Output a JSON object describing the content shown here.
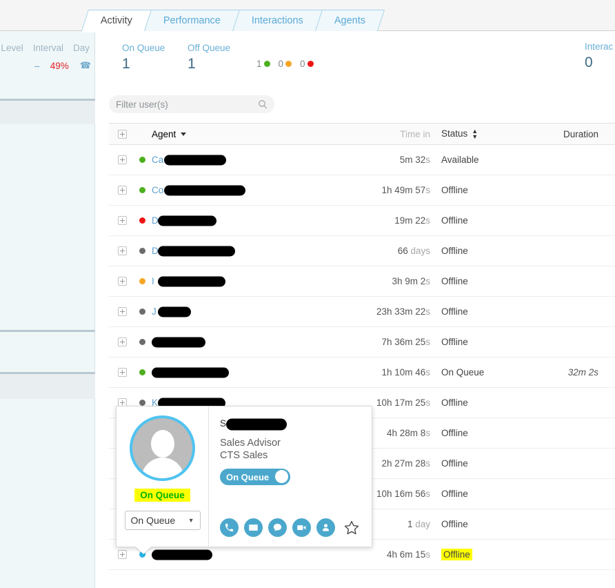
{
  "tabs": [
    {
      "label": "Activity",
      "active": true
    },
    {
      "label": "Performance",
      "active": false
    },
    {
      "label": "Interactions",
      "active": false
    },
    {
      "label": "Agents",
      "active": false
    }
  ],
  "left_panel": {
    "headers": [
      "Level",
      "Interval",
      "Day"
    ],
    "interval_value": "--",
    "day_value": "49%",
    "phone_icon": "phone-handset-icon"
  },
  "kpis": [
    {
      "label": "On Queue",
      "value": "1"
    },
    {
      "label": "Off Queue",
      "value": "1"
    },
    {
      "label": "Interac",
      "value": "0"
    }
  ],
  "status_counts": [
    {
      "count": "1",
      "color": "#4caf1f"
    },
    {
      "count": "0",
      "color": "#f5a623"
    },
    {
      "count": "0",
      "color": "#ef1414"
    }
  ],
  "filter": {
    "placeholder": "Filter user(s)",
    "value": "",
    "icon": "search-icon"
  },
  "table": {
    "columns": {
      "expand": "",
      "agent": "Agent",
      "time_in": "Time in",
      "status": "Status",
      "duration": "Duration"
    },
    "rows": [
      {
        "dot": "#4caf1f",
        "name_prefix": "Ca",
        "redact_w": 90,
        "time_num": "5m 32",
        "time_unit": "s",
        "time_pre": "",
        "status": "Available",
        "status_hl": false,
        "duration": ""
      },
      {
        "dot": "#4caf1f",
        "name_prefix": "Co",
        "redact_w": 118,
        "time_num": "1h 49m 57",
        "time_unit": "s",
        "time_pre": "",
        "status": "Offline",
        "status_hl": false,
        "duration": ""
      },
      {
        "dot": "#ef1414",
        "name_prefix": "D",
        "redact_w": 85,
        "time_num": "19m 22",
        "time_unit": "s",
        "time_pre": "",
        "status": "Offline",
        "status_hl": false,
        "duration": ""
      },
      {
        "dot": "#6b6b6b",
        "name_prefix": "D",
        "redact_w": 112,
        "time_num": "66 ",
        "time_unit": "days",
        "time_pre": "",
        "status": "Offline",
        "status_hl": false,
        "duration": ""
      },
      {
        "dot": "#f5a623",
        "name_prefix": "I",
        "redact_w": 98,
        "time_num": "3h 9m 2",
        "time_unit": "s",
        "time_pre": "",
        "status": "Offline",
        "status_hl": false,
        "duration": ""
      },
      {
        "dot": "#6b6b6b",
        "name_prefix": "J",
        "redact_w": 48,
        "time_num": "23h 33m 22",
        "time_unit": "s",
        "time_pre": "",
        "status": "Offline",
        "status_hl": false,
        "duration": ""
      },
      {
        "dot": "#6b6b6b",
        "name_prefix": "",
        "redact_w": 78,
        "time_num": "7h 36m 25",
        "time_unit": "s",
        "time_pre": "",
        "status": "Offline",
        "status_hl": false,
        "duration": ""
      },
      {
        "dot": "#4caf1f",
        "name_prefix": "",
        "redact_w": 112,
        "time_num": "1h 10m 46",
        "time_unit": "s",
        "time_pre": "",
        "status": "On Queue",
        "status_hl": false,
        "duration": "32m 2s"
      },
      {
        "dot": "#6b6b6b",
        "name_prefix": "K",
        "redact_w": 98,
        "time_num": "10h 17m 25",
        "time_unit": "s",
        "time_pre": "",
        "status": "Offline",
        "status_hl": false,
        "duration": ""
      },
      {
        "dot": "#6b6b6b",
        "name_prefix": "",
        "redact_w": 0,
        "time_num": "4h 28m 8",
        "time_unit": "s",
        "time_pre": "",
        "status": "Offline",
        "status_hl": false,
        "duration": ""
      },
      {
        "dot": "#6b6b6b",
        "name_prefix": "",
        "redact_w": 0,
        "time_num": "2h 27m 28",
        "time_unit": "s",
        "time_pre": "",
        "status": "Offline",
        "status_hl": false,
        "duration": ""
      },
      {
        "dot": "#6b6b6b",
        "name_prefix": "",
        "redact_w": 0,
        "time_num": "10h 16m 56",
        "time_unit": "s",
        "time_pre": "",
        "status": "Offline",
        "status_hl": false,
        "duration": ""
      },
      {
        "dot": "#6b6b6b",
        "name_prefix": "",
        "redact_w": 0,
        "time_num": "1 ",
        "time_unit": "day",
        "time_pre": "",
        "status": "Offline",
        "status_hl": false,
        "duration": ""
      },
      {
        "dot": "#2bb7ea",
        "name_prefix": "",
        "redact_w": 88,
        "time_num": "4h 6m 15",
        "time_unit": "s",
        "time_pre": "",
        "status": "Offline",
        "status_hl": true,
        "duration": ""
      }
    ]
  },
  "profile_card": {
    "avatar_icon": "user-avatar-icon",
    "presence_badge": "On Queue",
    "status_select_value": "On Queue",
    "name_prefix": "S",
    "role": "Sales Advisor",
    "team": "CTS Sales",
    "toggle_label": "On Queue",
    "actions": [
      {
        "icon": "phone-icon"
      },
      {
        "icon": "email-icon"
      },
      {
        "icon": "chat-icon"
      },
      {
        "icon": "video-icon"
      },
      {
        "icon": "profile-icon"
      }
    ],
    "favorite_icon": "star-outline-icon"
  },
  "colors": {
    "accent_blue": "#4ba8cc",
    "link_blue": "#5c9fce",
    "highlight_yellow": "#ffff00",
    "green": "#4caf1f",
    "red": "#ef1414",
    "orange": "#f5a623"
  }
}
